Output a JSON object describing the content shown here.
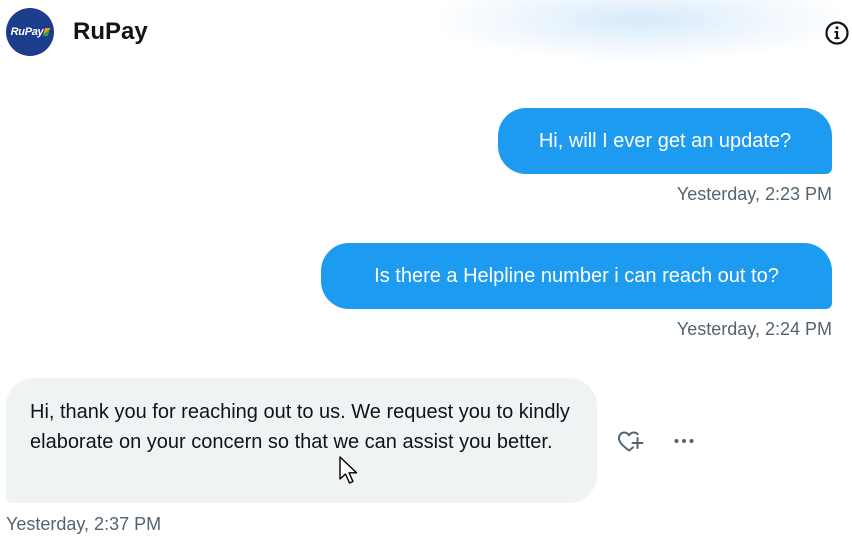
{
  "header": {
    "title": "RuPay",
    "avatar_text": "RuPay",
    "info_icon": "info-circle-icon"
  },
  "conversation": {
    "messages": [
      {
        "direction": "outgoing",
        "text": "Hi, will I ever get an update?",
        "timestamp": "Yesterday, 2:23 PM"
      },
      {
        "direction": "outgoing",
        "text": "Is there a Helpline number i can reach out to?",
        "timestamp": "Yesterday, 2:24 PM"
      },
      {
        "direction": "incoming",
        "text": "Hi, thank you for reaching out to us. We request you to kindly elaborate on your concern so that we can assist you better.",
        "timestamp": "Yesterday, 2:37 PM"
      }
    ],
    "message_actions": {
      "react_icon": "heart-plus-icon",
      "more_icon": "more-horizontal-icon"
    }
  },
  "colors": {
    "outgoing_bubble": "#1d9bf0",
    "incoming_bubble": "#eff3f4",
    "timestamp_text": "#536471",
    "primary_text": "#0f1419",
    "avatar_bg": "#1c3c8c"
  }
}
